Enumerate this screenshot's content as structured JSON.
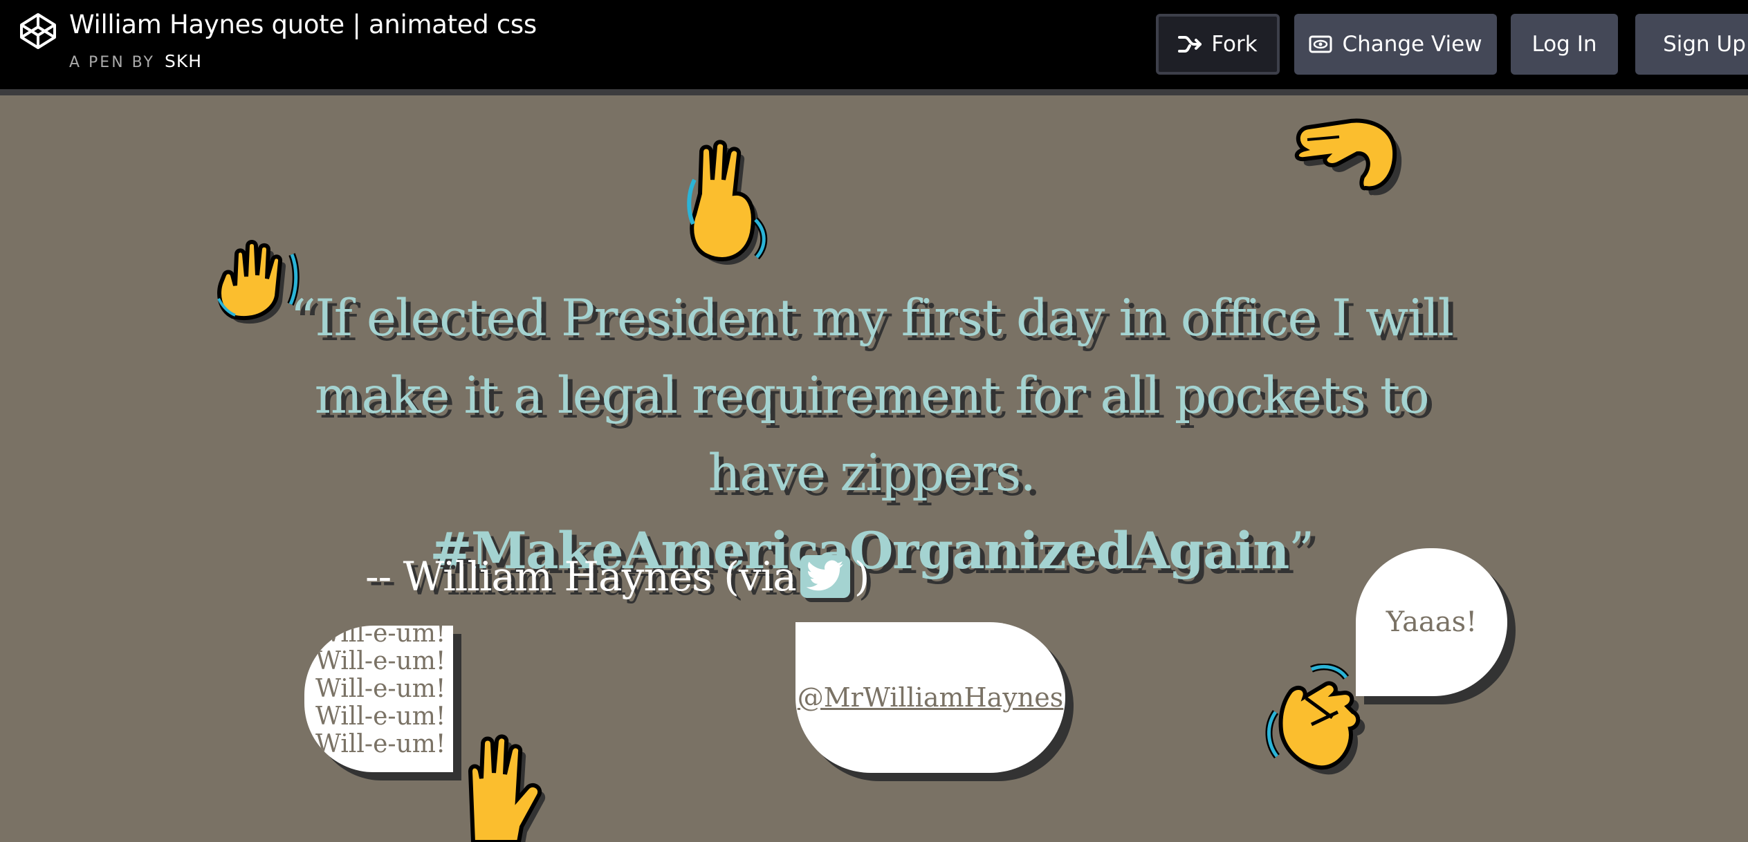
{
  "header": {
    "title": "William Haynes quote | animated css",
    "by_label": "A PEN BY",
    "author": "SKH",
    "buttons": {
      "fork": "Fork",
      "change_view": "Change View",
      "log_in": "Log In",
      "sign_up": "Sign Up"
    }
  },
  "quote": {
    "open_mark": "“",
    "text": "If elected President my first day in office I will make it a legal requirement for all pockets to have zippers.",
    "hashtag": "#MakeAmericaOrganizedAgain",
    "close_mark": "”"
  },
  "attribution": {
    "prefix": "-- William Haynes (via",
    "suffix": ")"
  },
  "bubbles": {
    "chant": [
      "Will-e-um!",
      "Will-e-um!",
      "Will-e-um!",
      "Will-e-um!",
      "Will-e-um!"
    ],
    "handle": "@MrWilliamHaynes",
    "cheer": "Yaaas!"
  },
  "colors": {
    "background": "#7a7265",
    "quote_text": "#a4d3d1",
    "hand_yellow": "#fbbe2e",
    "wave_blue": "#2bb3d6"
  },
  "icons": [
    "codepen-logo-icon",
    "fork-icon",
    "eye-icon",
    "twitter-bird-icon",
    "raised-hand-icon",
    "waving-hand-icon",
    "clapping-hands-icon",
    "pinching-hand-icon"
  ]
}
